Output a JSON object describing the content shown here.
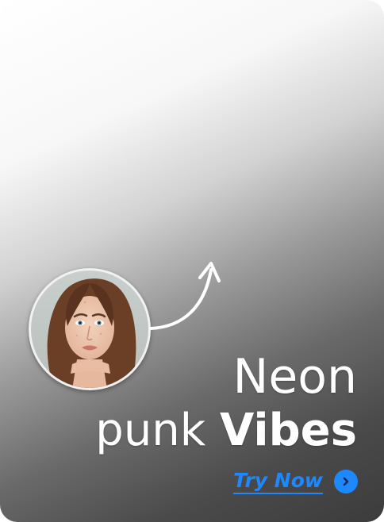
{
  "headline": {
    "line1": "Neon",
    "line2_light": "punk",
    "line2_bold": "Vibes"
  },
  "cta": {
    "label": "Try Now",
    "icon": "chevron-right-icon"
  },
  "avatar": {
    "icon": "portrait-photo"
  },
  "colors": {
    "accent": "#1E88FF",
    "text": "#FFFFFF",
    "ring": "#F1F1F1"
  }
}
